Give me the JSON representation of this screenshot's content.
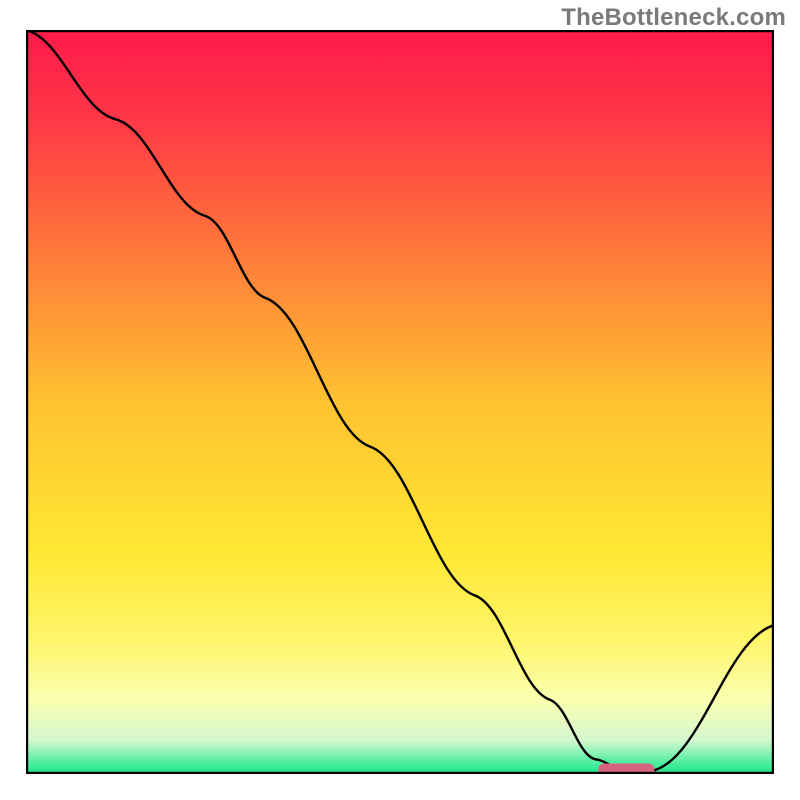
{
  "watermark": "TheBottleneck.com",
  "chart_data": {
    "type": "line",
    "title": "",
    "xlabel": "",
    "ylabel": "",
    "xlim": [
      0,
      100
    ],
    "ylim": [
      0,
      100
    ],
    "gradient_stops": [
      {
        "offset": 0.0,
        "color": "#ff1a4b"
      },
      {
        "offset": 0.12,
        "color": "#ff3747"
      },
      {
        "offset": 0.3,
        "color": "#ff7a3a"
      },
      {
        "offset": 0.5,
        "color": "#ffc231"
      },
      {
        "offset": 0.7,
        "color": "#ffe733"
      },
      {
        "offset": 0.82,
        "color": "#fff56a"
      },
      {
        "offset": 0.9,
        "color": "#fbffb0"
      },
      {
        "offset": 0.955,
        "color": "#d4f7cf"
      },
      {
        "offset": 0.985,
        "color": "#4eee9e"
      },
      {
        "offset": 1.0,
        "color": "#1ee686"
      }
    ],
    "curve": {
      "x": [
        0.0,
        12.0,
        24.0,
        32.0,
        46.0,
        60.0,
        70.0,
        76.0,
        80.0,
        84.0,
        100.0
      ],
      "y": [
        100.0,
        88.0,
        75.0,
        64.0,
        44.0,
        24.0,
        10.0,
        2.0,
        0.5,
        0.5,
        20.0
      ]
    },
    "marker": {
      "x_start": 76.5,
      "x_end": 84.0,
      "y": 0.6,
      "color": "#d9637e"
    },
    "frame_color": "#000000"
  }
}
